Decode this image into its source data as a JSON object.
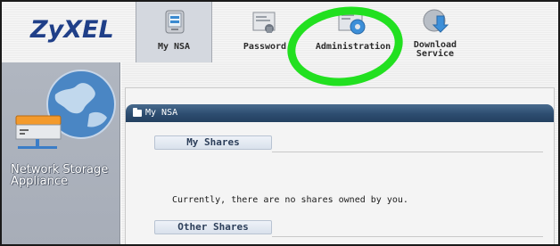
{
  "app": {
    "logo": "ZyXEL",
    "product": "Network Storage\nAppliance"
  },
  "nav": {
    "tabs": [
      {
        "label": "My NSA",
        "icon": "my-nsa-icon",
        "active": true
      },
      {
        "label": "Password",
        "icon": "password-icon",
        "active": false
      },
      {
        "label": "Administration",
        "icon": "administration-icon",
        "active": false
      },
      {
        "label": "Download\nService",
        "icon": "download-service-icon",
        "active": false
      }
    ]
  },
  "panel": {
    "title": "My NSA",
    "my_shares": {
      "label": "My Shares",
      "message": "Currently, there are no shares owned by you."
    },
    "other_shares": {
      "label": "Other Shares"
    }
  },
  "colors": {
    "highlight": "#22e020",
    "logo": "#1f3f88",
    "header": "#2d4d70"
  }
}
